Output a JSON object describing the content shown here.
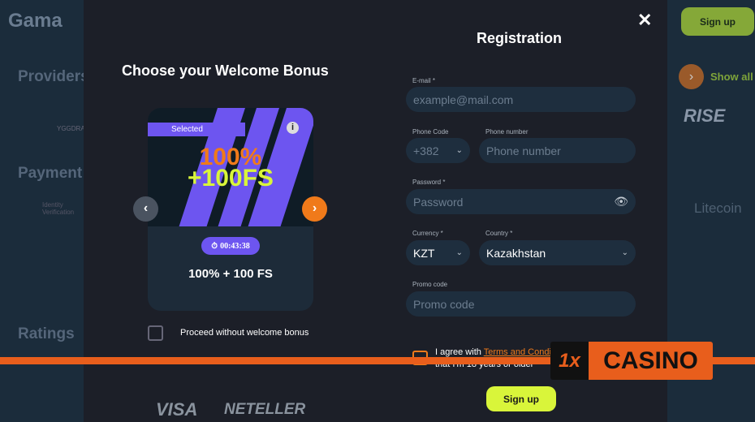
{
  "background": {
    "logo": "Gama",
    "providers": "Providers",
    "payment": "Payment",
    "ratings": "Ratings",
    "show_all": "Show all",
    "signup": "Sign up",
    "litecoin": "Litecoin",
    "yggdrasil": "YGGDRA",
    "hotrise": "RISE",
    "identity": "Identity Verification"
  },
  "bonus": {
    "title": "Choose your Welcome Bonus",
    "selected": "Selected",
    "headline1": "100%",
    "headline2": "+100FS",
    "timer": "00:43:38",
    "name": "100% + 100 FS",
    "proceed_without": "Proceed without welcome bonus"
  },
  "registration": {
    "title": "Registration",
    "email_label": "E-mail *",
    "email_placeholder": "example@mail.com",
    "phone_code_label": "Phone Code",
    "phone_code": "+382",
    "phone_label": "Phone number",
    "phone_placeholder": "Phone number",
    "password_label": "Password *",
    "password_placeholder": "Password",
    "currency_label": "Currency *",
    "currency": "KZT",
    "country_label": "Country *",
    "country": "Kazakhstan",
    "promo_label": "Promo code",
    "promo_placeholder": "Promo code",
    "agree_prefix": "I agree with ",
    "terms_link": "Terms and Conditions",
    "agree_line2": "that I'm 18 years or older",
    "signup": "Sign up"
  },
  "payments": {
    "visa": "VISA",
    "neteller": "NETELLER"
  },
  "watermark": {
    "brand": "CASINO",
    "logo": "1x"
  },
  "colors": {
    "accent_orange": "#f07a1a",
    "lime": "#d9f53a",
    "purple": "#6d55f0"
  }
}
